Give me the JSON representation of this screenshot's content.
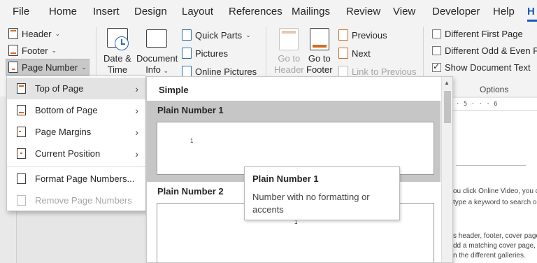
{
  "tabs": [
    "File",
    "Home",
    "Insert",
    "Design",
    "Layout",
    "References",
    "Mailings",
    "Review",
    "View",
    "Developer",
    "Help",
    "H"
  ],
  "ribbon": {
    "header_label": "Header",
    "footer_label": "Footer",
    "page_number_label": "Page Number",
    "date_time_line1": "Date &",
    "date_time_line2": "Time",
    "document_info_line1": "Document",
    "document_info_line2": "Info",
    "quick_parts_label": "Quick Parts",
    "pictures_label": "Pictures",
    "online_pictures_label": "Online Pictures",
    "go_to_header_line1": "Go to",
    "go_to_header_line2": "Header",
    "go_to_footer_line1": "Go to",
    "go_to_footer_line2": "Footer",
    "previous_label": "Previous",
    "next_label": "Next",
    "link_to_previous_label": "Link to Previous",
    "different_first_page_label": "Different First Page",
    "different_odd_even_label": "Different Odd & Even P",
    "show_document_text_label": "Show Document Text",
    "options_group_label": "Options"
  },
  "options_state": {
    "different_first_page": false,
    "different_odd_even": false,
    "show_document_text": true
  },
  "menu": {
    "items": [
      {
        "label": "Top of Page",
        "submenu": true,
        "highlighted": true,
        "enabled": true
      },
      {
        "label": "Bottom of Page",
        "submenu": true,
        "highlighted": false,
        "enabled": true
      },
      {
        "label": "Page Margins",
        "submenu": true,
        "highlighted": false,
        "enabled": true
      },
      {
        "label": "Current Position",
        "submenu": true,
        "highlighted": false,
        "enabled": true
      },
      {
        "label": "Format Page Numbers...",
        "submenu": false,
        "highlighted": false,
        "enabled": true
      },
      {
        "label": "Remove Page Numbers",
        "submenu": false,
        "highlighted": false,
        "enabled": false
      }
    ]
  },
  "gallery": {
    "section_title": "Simple",
    "items": [
      {
        "label": "Plain Number 1",
        "selected": true,
        "number": "1"
      },
      {
        "label": "Plain Number 2",
        "selected": false,
        "number": "1"
      }
    ]
  },
  "tooltip": {
    "title": "Plain Number 1",
    "description": "Number with no formatting or accents"
  },
  "ruler": {
    "ticks": "· 5 · · · 6"
  },
  "document_text": [
    "ou click Online Video, you ca",
    "type a keyword to search onl",
    "s header, footer, cover page,",
    "dd a matching cover page, he",
    "n the different galleries."
  ],
  "colors": {
    "accent_blue": "#185abd",
    "icon_orange": "#d16c21",
    "menu_highlight": "#e3e3e3",
    "gallery_selected": "#c6c6c6"
  }
}
